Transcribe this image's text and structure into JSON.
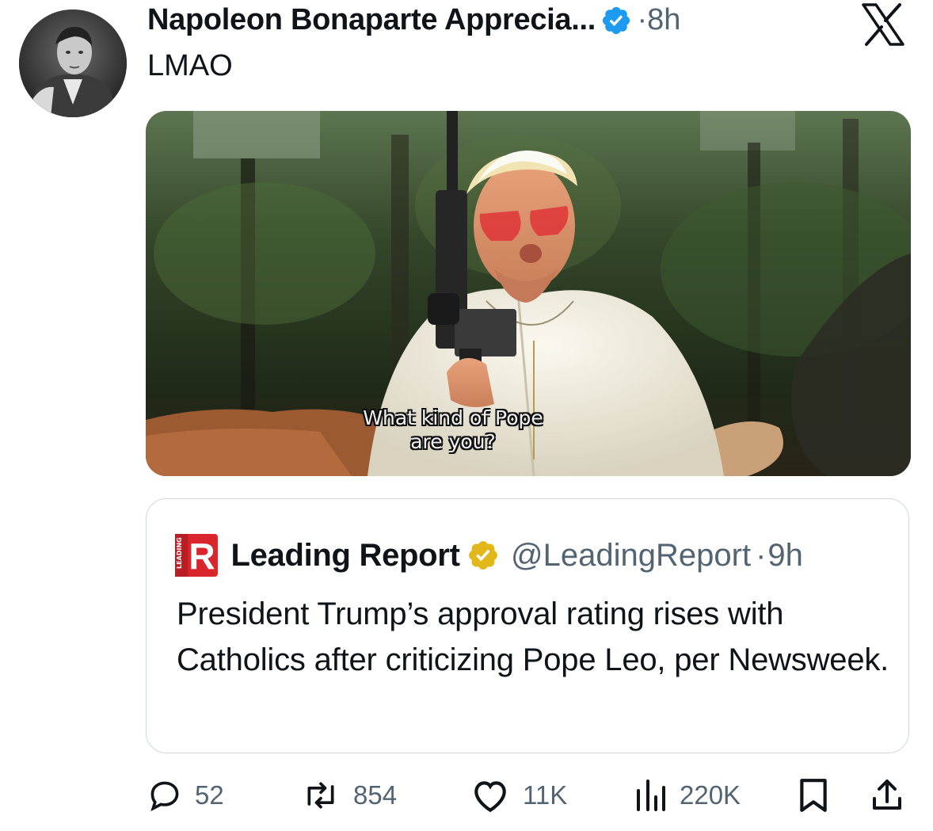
{
  "post": {
    "author": "Napoleon Bonaparte Apprecia...",
    "verified_icon": "verified-badge-icon",
    "time": "8h",
    "separator": "·",
    "text": "LMAO",
    "platform_logo": "x-logo-icon"
  },
  "media": {
    "caption_line1": "What kind of Pope",
    "caption_line2": "are you?"
  },
  "quote": {
    "logo_letter": "R",
    "logo_side_text": "LEADING",
    "name": "Leading Report",
    "handle": "@LeadingReport",
    "separator": "·",
    "time": "9h",
    "text": "President Trump’s approval rating rises with Catholics after criticizing Pope Leo, per Newsweek."
  },
  "actions": {
    "replies": "52",
    "reposts": "854",
    "likes": "11K",
    "views": "220K",
    "bookmark_icon": "bookmark-icon",
    "share_icon": "share-icon"
  },
  "colors": {
    "verified_blue": "#1d9bf0",
    "gold_badge": "#e2b719",
    "secondary_text": "#536471",
    "border": "#cfd9de",
    "brand_red": "#d9262c"
  }
}
